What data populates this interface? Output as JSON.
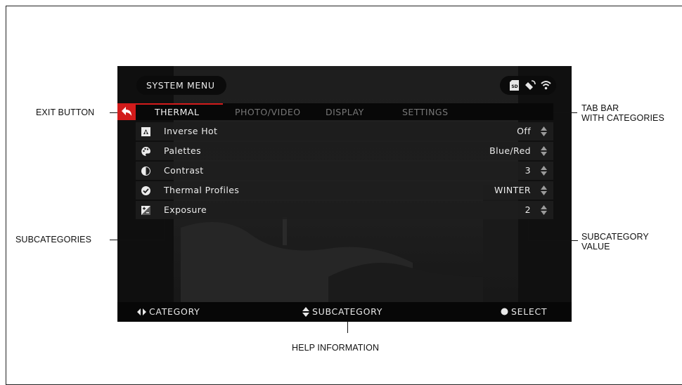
{
  "status_bar": {
    "title": "SYSTEM MENU",
    "icons": [
      "sd-card-icon",
      "gps-icon",
      "wifi-icon"
    ]
  },
  "tabs": [
    {
      "label": "THERMAL",
      "active": true
    },
    {
      "label": "PHOTO/VIDEO",
      "active": false
    },
    {
      "label": "DISPLAY",
      "active": false
    },
    {
      "label": "SETTINGS",
      "active": false
    }
  ],
  "menu": {
    "items": [
      {
        "icon": "inverse-hot-icon",
        "label": "Inverse Hot",
        "value": "Off"
      },
      {
        "icon": "palette-icon",
        "label": "Palettes",
        "value": "Blue/Red"
      },
      {
        "icon": "contrast-icon",
        "label": "Contrast",
        "value": "3"
      },
      {
        "icon": "check-circle-icon",
        "label": "Thermal Profiles",
        "value": "WINTER"
      },
      {
        "icon": "exposure-icon",
        "label": "Exposure",
        "value": "2"
      }
    ]
  },
  "help": {
    "category": "CATEGORY",
    "subcategory": "SUBCATEGORY",
    "select": "SELECT"
  },
  "annotations": {
    "exit_button": "EXIT BUTTON",
    "tab_bar_line1": "TAB BAR",
    "tab_bar_line2": "WITH CATEGORIES",
    "subcategories": "SUBCATEGORIES",
    "subcategory_value_line1": "SUBCATEGORY",
    "subcategory_value_line2": "VALUE",
    "help_information": "HELP INFORMATION"
  },
  "colors": {
    "accent": "#d21b1b",
    "screen_bg": "#141414",
    "text": "#ececec",
    "inactive_tab": "#777777"
  }
}
